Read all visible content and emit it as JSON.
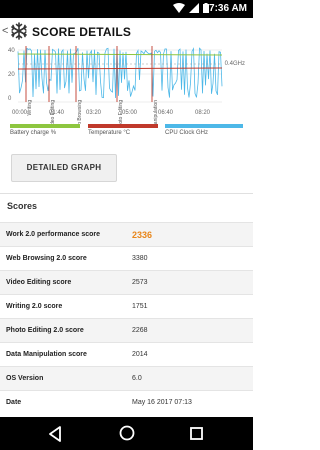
{
  "status_bar": {
    "time": "7:36 AM"
  },
  "app_bar": {
    "title": "SCORE DETAILS",
    "back_glyph": "<"
  },
  "graph": {
    "y_ticks": [
      "40",
      "20",
      "0"
    ],
    "x_ticks": [
      "00:00",
      "01:40",
      "03:20",
      "05:00",
      "06:40",
      "08:20"
    ],
    "right_label": "0.4GHz",
    "markers": [
      "Writing",
      "Video Editing",
      "Web Browsing",
      "Photo Editing",
      "Data Manipulation"
    ],
    "colors": {
      "battery": "#8dc63f",
      "temperature": "#c0392b",
      "cpu": "#4db8e8",
      "marker": "#c0392b"
    }
  },
  "legend": [
    {
      "label": "Battery charge %",
      "color": "#8dc63f"
    },
    {
      "label": "Temperature °C",
      "color": "#c0392b"
    },
    {
      "label": "CPU Clock GHz",
      "color": "#4db8e8"
    }
  ],
  "detailed_graph_button": "DETAILED GRAPH",
  "scores_header": "Scores",
  "scores": [
    {
      "label": "Work 2.0 performance score",
      "value": "2336",
      "highlight": true
    },
    {
      "label": "Web Browsing 2.0 score",
      "value": "3380"
    },
    {
      "label": "Video Editing score",
      "value": "2573"
    },
    {
      "label": "Writing 2.0 score",
      "value": "1751"
    },
    {
      "label": "Photo Editing 2.0 score",
      "value": "2268"
    },
    {
      "label": "Data Manipulation score",
      "value": "2014"
    },
    {
      "label": "OS Version",
      "value": "6.0"
    },
    {
      "label": "Date",
      "value": "May 16 2017 07:13"
    }
  ]
}
